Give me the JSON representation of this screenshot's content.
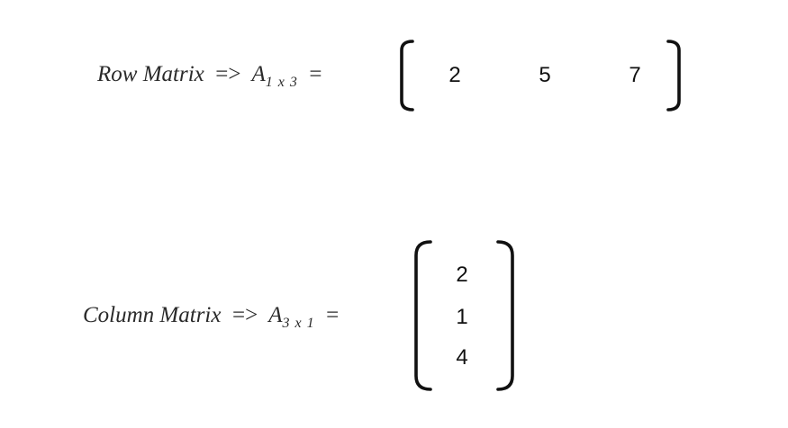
{
  "row_matrix": {
    "label": "Row Matrix",
    "arrow": "=>",
    "symbol": "A",
    "subscript": "1 x 3",
    "equals": "=",
    "entries": [
      "2",
      "5",
      "7"
    ]
  },
  "column_matrix": {
    "label": "Column Matrix",
    "arrow": "=>",
    "symbol": "A",
    "subscript": "3 x 1",
    "equals": "=",
    "entries": [
      "2",
      "1",
      "4"
    ]
  }
}
